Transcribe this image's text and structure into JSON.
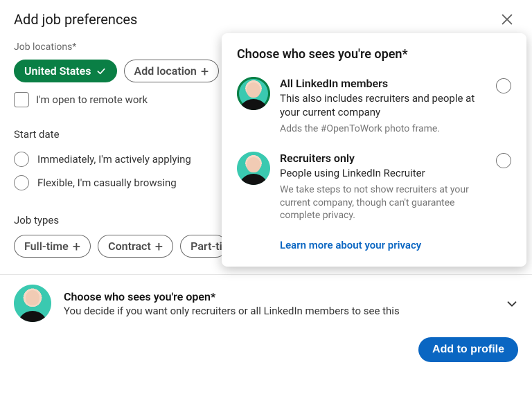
{
  "modal": {
    "title": "Add job preferences"
  },
  "jobLocations": {
    "label": "Job locations*",
    "selected": "United States",
    "addLabel": "Add location"
  },
  "remote": {
    "label": "I'm open to remote work"
  },
  "startDate": {
    "heading": "Start date",
    "options": [
      "Immediately, I'm actively applying",
      "Flexible, I'm casually browsing"
    ]
  },
  "jobTypes": {
    "heading": "Job types",
    "items": [
      "Full-time",
      "Contract",
      "Part-ti"
    ]
  },
  "visibility": {
    "title": "Choose who sees you're open*",
    "options": [
      {
        "title": "All LinkedIn members",
        "sub": "This also includes recruiters and people at your current company",
        "note": "Adds the #OpenToWork photo frame."
      },
      {
        "title": "Recruiters only",
        "sub": "People using LinkedIn Recruiter",
        "note": "We take steps to not show recruiters at your current company, though can't guarantee complete privacy."
      }
    ],
    "learnMore": "Learn more about your privacy"
  },
  "footer": {
    "title": "Choose who sees you're open*",
    "sub": "You decide if you want only recruiters or all LinkedIn members to see this"
  },
  "actions": {
    "addToProfile": "Add to profile"
  }
}
